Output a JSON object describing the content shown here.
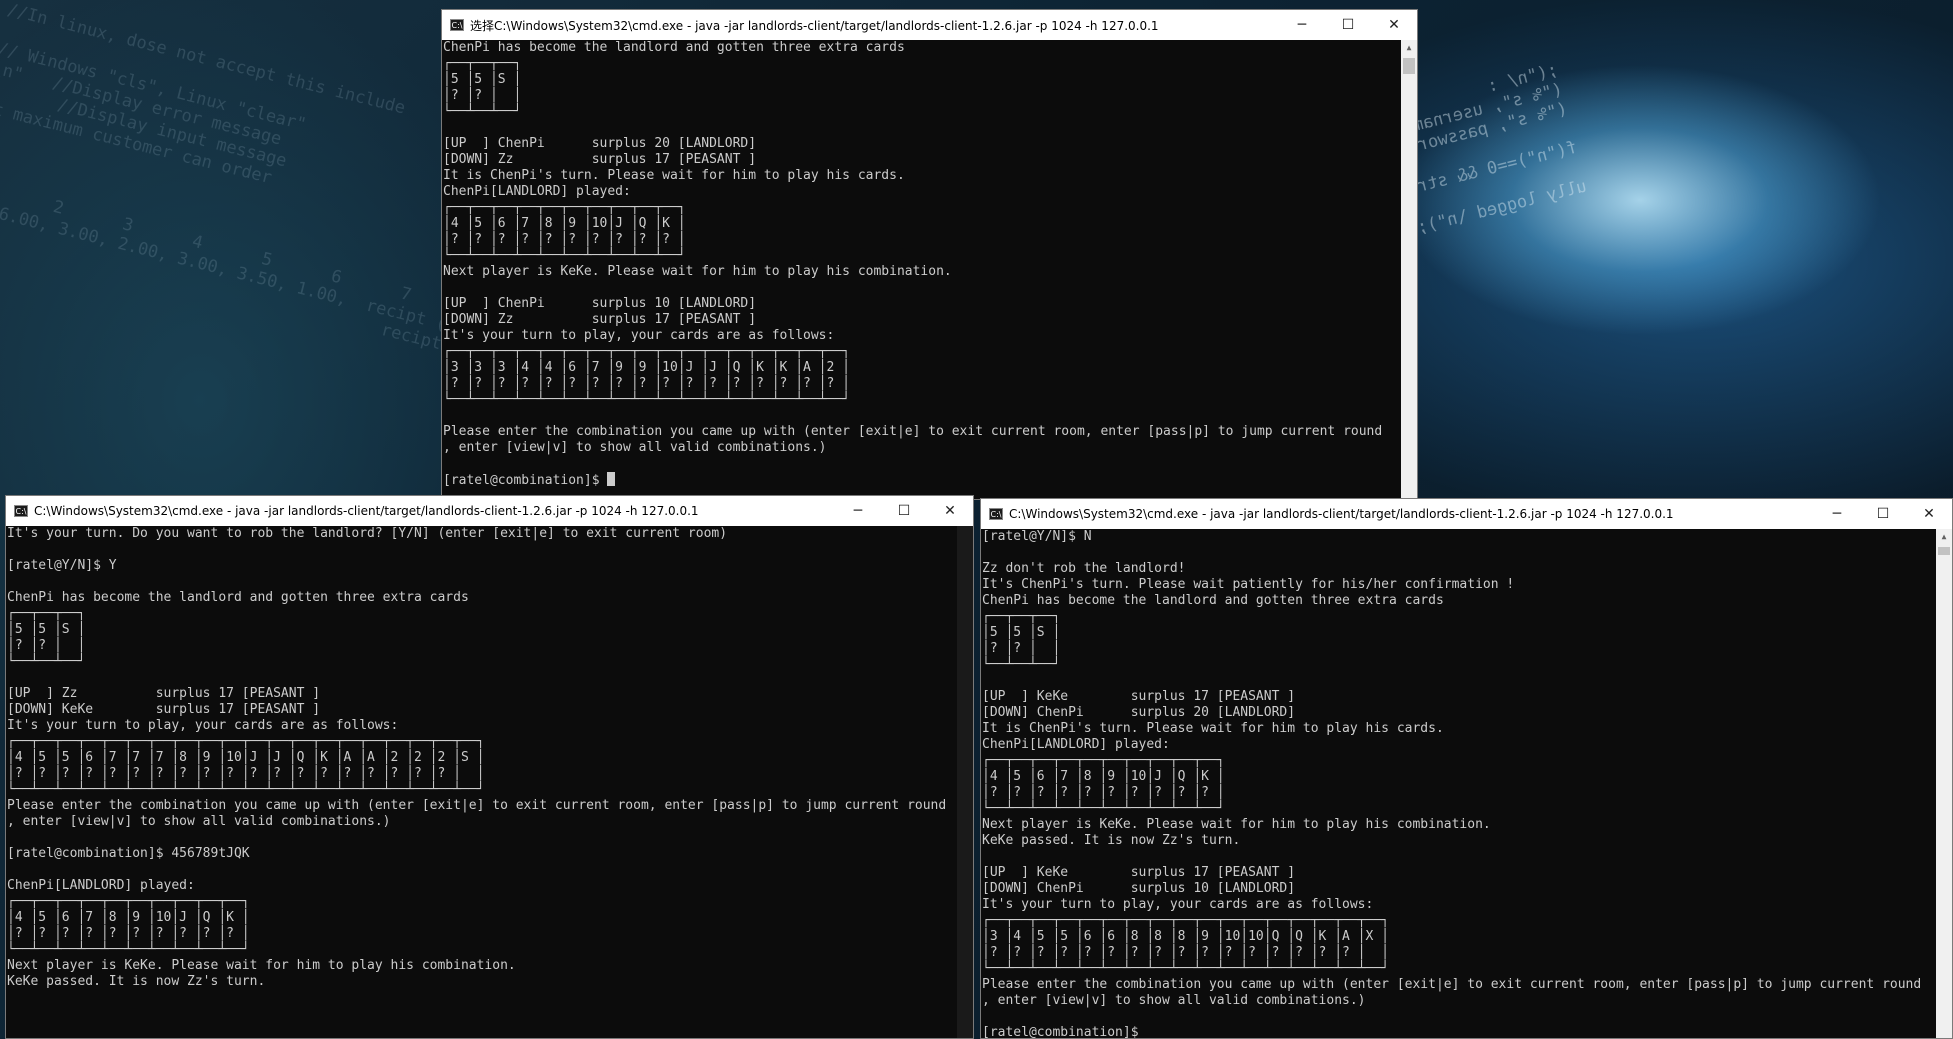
{
  "desktop": {
    "code_left": "//In linux, dose not accept this include\n\n// Windows \"cls\", Linux \"clear\"\n\\n\"   //Display error message\n       //Display input message\nat maximum customer can order\n\n\n\n  1      2      3      4      5      6      7\n00, 6.00, 3.00, 2.00, 3.00, 3.50, 1.00,  recipt (with qu\n                                           recipt[MAX];",
    "code_right": ";(\"n/ :\n(\"% s\", username); scanf\n(\"% s\", password); scanf\n\nf(\"n\")==0 && strcmp(password, \"freeman\")==0) || (strcmp(username,\n\nully logged \\n\");"
  },
  "windows": {
    "top": {
      "title": "选择C:\\Windows\\System32\\cmd.exe - java  -jar landlords-client/target/landlords-client-1.2.6.jar -p 1024 -h 127.0.0.1",
      "lines": [
        "ChenPi has become the landlord and gotten three extra cards",
        "┌──┬──┬──┐",
        "│5 │5 │S │",
        "│? │? │  │",
        "└──┴──┴──┘",
        "",
        "[UP  ] ChenPi      surplus 20 [LANDLORD]",
        "[DOWN] Zz          surplus 17 [PEASANT ]",
        "It is ChenPi's turn. Please wait for him to play his cards.",
        "ChenPi[LANDLORD] played:",
        "┌──┬──┬──┬──┬──┬──┬──┬──┬──┬──┐",
        "│4 │5 │6 │7 │8 │9 │10│J │Q │K │",
        "│? │? │? │? │? │? │? │? │? │? │",
        "└──┴──┴──┴──┴──┴──┴──┴──┴──┴──┘",
        "Next player is KeKe. Please wait for him to play his combination.",
        "",
        "[UP  ] ChenPi      surplus 10 [LANDLORD]",
        "[DOWN] Zz          surplus 17 [PEASANT ]",
        "It's your turn to play, your cards are as follows:",
        "┌──┬──┬──┬──┬──┬──┬──┬──┬──┬──┬──┬──┬──┬──┬──┬──┬──┐",
        "│3 │3 │3 │4 │4 │6 │7 │9 │9 │10│J │J │Q │K │K │A │2 │",
        "│? │? │? │? │? │? │? │? │? │? │? │? │? │? │? │? │? │",
        "└──┴──┴──┴──┴──┴──┴──┴──┴──┴──┴──┴──┴──┴──┴──┴──┴──┘",
        "",
        "Please enter the combination you came up with (enter [exit|e] to exit current room, enter [pass|p] to jump current round",
        ", enter [view|v] to show all valid combinations.)",
        "",
        "[ratel@combination]$"
      ]
    },
    "bottom_left": {
      "title": "C:\\Windows\\System32\\cmd.exe - java  -jar landlords-client/target/landlords-client-1.2.6.jar -p 1024 -h 127.0.0.1",
      "lines": [
        "It's your turn. Do you want to rob the landlord? [Y/N] (enter [exit|e] to exit current room)",
        "",
        "[ratel@Y/N]$ Y",
        "",
        "ChenPi has become the landlord and gotten three extra cards",
        "┌──┬──┬──┐",
        "│5 │5 │S │",
        "│? │? │  │",
        "└──┴──┴──┘",
        "",
        "[UP  ] Zz          surplus 17 [PEASANT ]",
        "[DOWN] KeKe        surplus 17 [PEASANT ]",
        "It's your turn to play, your cards are as follows:",
        "┌──┬──┬──┬──┬──┬──┬──┬──┬──┬──┬──┬──┬──┬──┬──┬──┬──┬──┬──┬──┐",
        "│4 │5 │5 │6 │7 │7 │7 │8 │9 │10│J │J │Q │K │A │A │2 │2 │2 │S │",
        "│? │? │? │? │? │? │? │? │? │? │? │? │? │? │? │? │? │? │? │  │",
        "└──┴──┴──┴──┴──┴──┴──┴──┴──┴──┴──┴──┴──┴──┴──┴──┴──┴──┴──┴──┘",
        "Please enter the combination you came up with (enter [exit|e] to exit current room, enter [pass|p] to jump current round",
        ", enter [view|v] to show all valid combinations.)",
        "",
        "[ratel@combination]$ 456789tJQK",
        "",
        "ChenPi[LANDLORD] played:",
        "┌──┬──┬──┬──┬──┬──┬──┬──┬──┬──┐",
        "│4 │5 │6 │7 │8 │9 │10│J │Q │K │",
        "│? │? │? │? │? │? │? │? │? │? │",
        "└──┴──┴──┴──┴──┴──┴──┴──┴──┴──┘",
        "Next player is KeKe. Please wait for him to play his combination.",
        "KeKe passed. It is now Zz's turn."
      ]
    },
    "bottom_right": {
      "title": "C:\\Windows\\System32\\cmd.exe - java  -jar landlords-client/target/landlords-client-1.2.6.jar -p 1024 -h 127.0.0.1",
      "lines": [
        "[ratel@Y/N]$ N",
        "",
        "Zz don't rob the landlord!",
        "It's ChenPi's turn. Please wait patiently for his/her confirmation !",
        "ChenPi has become the landlord and gotten three extra cards",
        "┌──┬──┬──┐",
        "│5 │5 │S │",
        "│? │? │  │",
        "└──┴──┴──┘",
        "",
        "[UP  ] KeKe        surplus 17 [PEASANT ]",
        "[DOWN] ChenPi      surplus 20 [LANDLORD]",
        "It is ChenPi's turn. Please wait for him to play his cards.",
        "ChenPi[LANDLORD] played:",
        "┌──┬──┬──┬──┬──┬──┬──┬──┬──┬──┐",
        "│4 │5 │6 │7 │8 │9 │10│J │Q │K │",
        "│? │? │? │? │? │? │? │? │? │? │",
        "└──┴──┴──┴──┴──┴──┴──┴──┴──┴──┘",
        "Next player is KeKe. Please wait for him to play his combination.",
        "KeKe passed. It is now Zz's turn.",
        "",
        "[UP  ] KeKe        surplus 17 [PEASANT ]",
        "[DOWN] ChenPi      surplus 10 [LANDLORD]",
        "It's your turn to play, your cards are as follows:",
        "┌──┬──┬──┬──┬──┬──┬──┬──┬──┬──┬──┬──┬──┬──┬──┬──┬──┐",
        "│3 │4 │5 │5 │6 │6 │8 │8 │8 │9 │10│10│Q │Q │K │A │X │",
        "│? │? │? │? │? │? │? │? │? │? │? │? │? │? │? │? │  │",
        "└──┴──┴──┴──┴──┴──┴──┴──┴──┴──┴──┴──┴──┴──┴──┴──┴──┘",
        "Please enter the combination you came up with (enter [exit|e] to exit current room, enter [pass|p] to jump current round",
        ", enter [view|v] to show all valid combinations.)",
        "",
        "[ratel@combination]$"
      ]
    }
  },
  "icons": {
    "app": "cmd-icon",
    "minimize": "minimize-icon",
    "maximize": "maximize-icon",
    "close": "close-icon"
  },
  "colors": {
    "console_bg": "#0c0c0c",
    "console_text": "#cccccc",
    "titlebar_bg": "#ffffff"
  }
}
